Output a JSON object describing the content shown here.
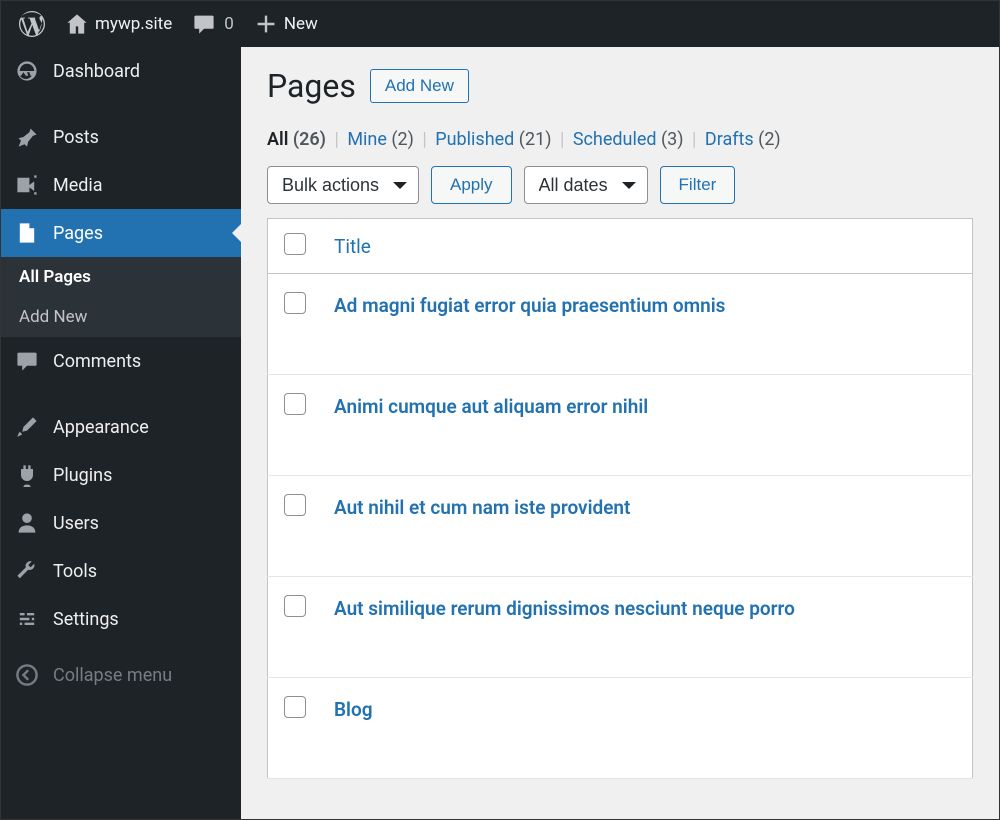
{
  "toolbar": {
    "site_name": "mywp.site",
    "comments_count": "0",
    "new_label": "New"
  },
  "sidebar": {
    "items": [
      {
        "label": "Dashboard"
      },
      {
        "label": "Posts"
      },
      {
        "label": "Media"
      },
      {
        "label": "Pages"
      },
      {
        "label": "Comments"
      },
      {
        "label": "Appearance"
      },
      {
        "label": "Plugins"
      },
      {
        "label": "Users"
      },
      {
        "label": "Tools"
      },
      {
        "label": "Settings"
      }
    ],
    "submenu": [
      {
        "label": "All Pages"
      },
      {
        "label": "Add New"
      }
    ],
    "collapse_label": "Collapse menu"
  },
  "header": {
    "title": "Pages",
    "add_new_label": "Add New"
  },
  "filters": {
    "all_label": "All",
    "all_count": "(26)",
    "mine_label": "Mine",
    "mine_count": "(2)",
    "published_label": "Published",
    "published_count": "(21)",
    "scheduled_label": "Scheduled",
    "scheduled_count": "(3)",
    "drafts_label": "Drafts",
    "drafts_count": "(2)"
  },
  "tablenav": {
    "bulk_label": "Bulk actions",
    "apply_label": "Apply",
    "dates_label": "All dates",
    "filter_label": "Filter"
  },
  "table": {
    "col_title": "Title",
    "rows": [
      {
        "title": "Ad magni fugiat error quia praesentium omnis"
      },
      {
        "title": "Animi cumque aut aliquam error nihil"
      },
      {
        "title": "Aut nihil et cum nam iste provident"
      },
      {
        "title": "Aut similique rerum dignissimos nesciunt neque porro"
      },
      {
        "title": "Blog"
      }
    ]
  }
}
